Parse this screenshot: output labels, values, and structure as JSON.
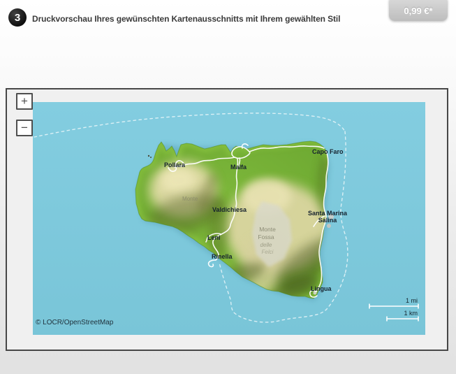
{
  "header": {
    "step_number": "3",
    "title": "Druckvorschau Ihres gewünschten Kartenausschnitts mit Ihrem gewählten Stil",
    "price": "0,99 €*"
  },
  "map": {
    "zoom_in_label": "+",
    "zoom_out_label": "−",
    "attribution": "© LOCR/OpenStreetMap",
    "scale_mi_label": "1 mi",
    "scale_km_label": "1 km",
    "place_labels": {
      "pollara": "Pollara",
      "malfa": "Malfa",
      "capo_faro": "Capo Faro",
      "valdichiesa": "Valdichiesa",
      "santa_marina_line1": "Santa Marina",
      "santa_marina_line2": "Salina",
      "leni": "Leni",
      "rinella": "Rinella",
      "lingua": "Lingua",
      "monte_dei_porri": "Monte",
      "monte_fossa_line1": "Monte",
      "monte_fossa_line2": "Fossa",
      "monte_fossa_line3": "delle",
      "monte_fossa_line4": "Felci"
    },
    "colors": {
      "water": "#7ec9dc",
      "land_green": "#74b236",
      "highland_tan": "#ddd7a2",
      "road": "#ffffff",
      "label_text": "#16222e",
      "ferry_route": "#e9f6f9"
    }
  }
}
